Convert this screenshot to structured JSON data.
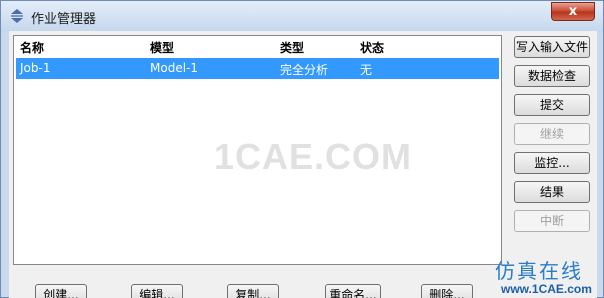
{
  "window": {
    "title": "作业管理器",
    "close_label": "x"
  },
  "table": {
    "columns": [
      "名称",
      "模型",
      "类型",
      "状态"
    ],
    "rows": [
      {
        "name": "Job-1",
        "model": "Model-1",
        "type": "完全分析",
        "status": "无",
        "selected": true
      }
    ]
  },
  "watermark": "1CAE.COM",
  "side_buttons": [
    {
      "label": "写入输入文件",
      "enabled": true
    },
    {
      "label": "数据检查",
      "enabled": true
    },
    {
      "label": "提交",
      "enabled": true
    },
    {
      "label": "继续",
      "enabled": false
    },
    {
      "label": "监控...",
      "enabled": true
    },
    {
      "label": "结果",
      "enabled": true
    },
    {
      "label": "中断",
      "enabled": false
    }
  ],
  "bottom_buttons": [
    {
      "label": "创建..."
    },
    {
      "label": "编辑..."
    },
    {
      "label": "复制..."
    },
    {
      "label": "重命名..."
    },
    {
      "label": "删除..."
    }
  ],
  "branding": {
    "line1": "仿真在线",
    "line2": "www.1CAE.com"
  },
  "colors": {
    "selection": "#3399ff",
    "disabled_text": "#a0a0a0"
  }
}
